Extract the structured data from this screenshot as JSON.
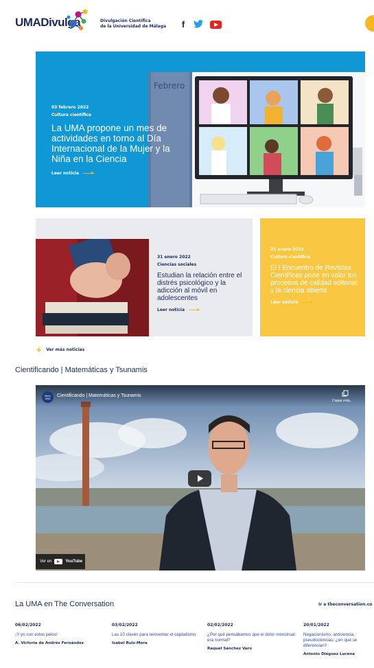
{
  "header": {
    "logo_text": "UMADivulga",
    "tagline_line1": "Divulgación Científica",
    "tagline_line2": "de la Universidad de Málaga",
    "social": [
      "facebook-icon",
      "twitter-icon",
      "youtube-icon"
    ],
    "brand_colors": {
      "navy": "#1b2a5c",
      "blue": "#0f97d6",
      "yellow": "#fac742",
      "orange": "#f6b820"
    }
  },
  "hero": {
    "date": "03 febrero 2022",
    "category": "Cultura científica",
    "title": "La UMA propone un mes de actividades en torno al Día Internacional de la Mujer y la Niña en la Ciencia",
    "link": "Leer noticia",
    "image_caption": "Febrero"
  },
  "cards": [
    {
      "date": "31 enero 2022",
      "category": "Ciencias sociales",
      "title": "Estudian la relación entre el distrés psicológico y la adicción al móvil en adolescentes",
      "link": "Leer noticia"
    },
    {
      "date": "21 enero 2022",
      "category": "Cultura científica",
      "title": "El I Encuentro de Revistas Científicas pone en valor los procesos de calidad editorial y la ciencia abierta",
      "link": "Leer noticia"
    }
  ],
  "more_news": "Ver más noticias",
  "video": {
    "heading": "Cientificando | Matemáticas y Tsunamis",
    "title": "Cientificando | Matemáticas y Tsunamis",
    "channel_avatar": "Mirar UMA",
    "copy_label": "Copiar enla...",
    "watch_on": "Ver en",
    "youtube": "YouTube"
  },
  "conversation": {
    "heading": "La UMA en The Conversation",
    "link": "Ir a theconversation.co",
    "articles": [
      {
        "date": "06/02/2022",
        "title": "¡Y yo con estos pelos!",
        "author": "A. Victoria de Andrés Fernández"
      },
      {
        "date": "03/02/2022",
        "title": "Las 10 claves para reinventar el capitalismo",
        "author": "Isabel Ruiz-Mora"
      },
      {
        "date": "02/02/2022",
        "title": "¿Por qué pensábamos que el dolor menstrual era normal?",
        "author": "Raquel Sánchez Varo"
      },
      {
        "date": "20/01/2022",
        "title": "Negacionismo, anticiencia, pseudociencias: ¿en qué se diferencian?",
        "author": "Antonio Diéguez Lucena"
      }
    ]
  }
}
